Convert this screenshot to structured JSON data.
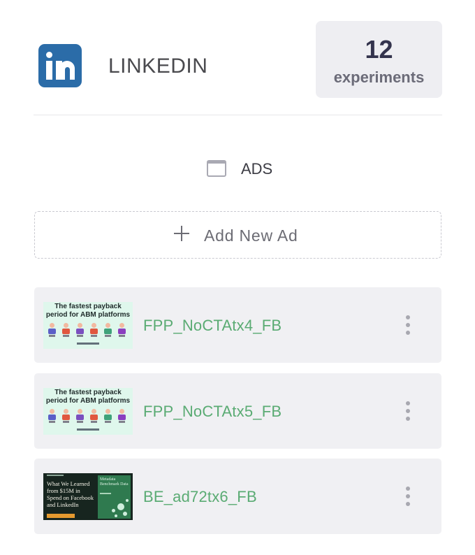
{
  "header": {
    "platform_name": "LINKEDIN",
    "logo_icon": "linkedin-icon",
    "brand_color": "#2b6ca8",
    "experiments_count": "12",
    "experiments_label": "experiments"
  },
  "ads_section": {
    "icon": "ad-frame-icon",
    "label": "ADS"
  },
  "add_button": {
    "icon": "plus-icon",
    "label": "Add New Ad"
  },
  "ads": [
    {
      "name": "FPP_NoCTAtx4_FB",
      "thumbnail_headline": "The fastest payback period for ABM platforms",
      "thumbnail_style": "mint",
      "menu_icon": "kebab-menu-icon"
    },
    {
      "name": "FPP_NoCTAtx5_FB",
      "thumbnail_headline": "The fastest payback period for ABM platforms",
      "thumbnail_style": "mint",
      "menu_icon": "kebab-menu-icon"
    },
    {
      "name": "BE_ad72tx6_FB",
      "thumbnail_headline": "What We Learned from $15M in Spend on Facebook and LinkedIn",
      "thumbnail_panel_title": "Metadata Benchmark Data",
      "thumbnail_style": "dark",
      "menu_icon": "kebab-menu-icon"
    }
  ],
  "colors": {
    "ad_name": "#5aab73",
    "card_background": "#f0f0f3",
    "experiments_box": "#eeeef2"
  }
}
